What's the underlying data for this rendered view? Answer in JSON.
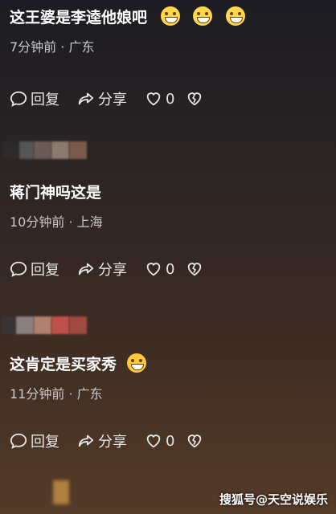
{
  "comments": [
    {
      "text": "这王婆是李逵他娘吧",
      "meta": "7分钟前 · 广东",
      "reply": "回复",
      "share": "分享",
      "likes": "0"
    },
    {
      "text": "蒋门神吗这是",
      "meta": "10分钟前 · 上海",
      "reply": "回复",
      "share": "分享",
      "likes": "0"
    },
    {
      "text": "这肯定是买家秀",
      "meta": "11分钟前 · 广东",
      "reply": "回复",
      "share": "分享",
      "likes": "0"
    }
  ],
  "watermark": "搜狐号@天空说娱乐",
  "icons": [
    "comment-icon",
    "share-icon",
    "heart-icon",
    "broken-heart-icon",
    "grin-emoji-icon",
    "laugh-cry-emoji-icon"
  ]
}
